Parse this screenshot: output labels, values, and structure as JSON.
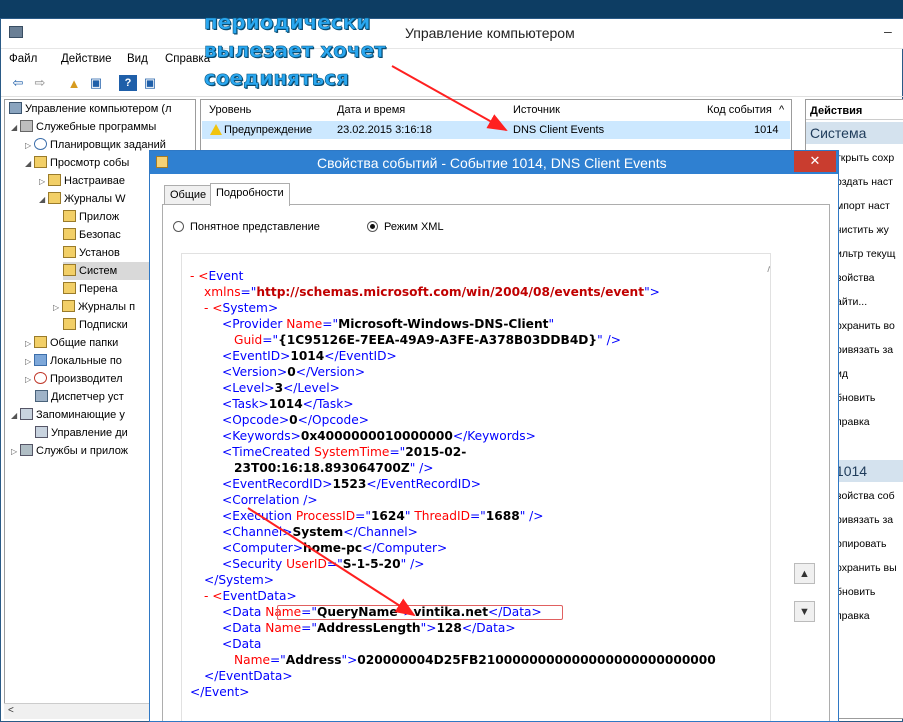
{
  "window": {
    "title": "Управление компьютером",
    "min_glyph": "–"
  },
  "menu": [
    "Файл",
    "Действие",
    "Вид",
    "Справка"
  ],
  "caption_lines": [
    "периодически",
    "вылезает хочет",
    "соединяться"
  ],
  "tree": [
    {
      "label": "Управление компьютером (л",
      "indent": 0
    },
    {
      "label": "Служебные программы",
      "indent": 1,
      "arrow": "◢"
    },
    {
      "label": "Планировщик заданий",
      "indent": 2,
      "arrow": "▷"
    },
    {
      "label": "Просмотр собы",
      "indent": 2,
      "arrow": "◢"
    },
    {
      "label": "Настраивае",
      "indent": 3,
      "arrow": "▷"
    },
    {
      "label": "Журналы W",
      "indent": 3,
      "arrow": "◢"
    },
    {
      "label": "Прилож",
      "indent": 4
    },
    {
      "label": "Безопас",
      "indent": 4
    },
    {
      "label": "Установ",
      "indent": 4
    },
    {
      "label": "Систем",
      "indent": 4
    },
    {
      "label": "Перена",
      "indent": 4
    },
    {
      "label": "Журналы п",
      "indent": 3,
      "arrow": "▷"
    },
    {
      "label": "Подписки",
      "indent": 3
    },
    {
      "label": "Общие папки",
      "indent": 2,
      "arrow": "▷"
    },
    {
      "label": "Локальные по",
      "indent": 2,
      "arrow": "▷"
    },
    {
      "label": "Производител",
      "indent": 2,
      "arrow": "▷"
    },
    {
      "label": "Диспетчер уст",
      "indent": 2
    },
    {
      "label": "Запоминающие у",
      "indent": 1,
      "arrow": "◢"
    },
    {
      "label": "Управление ди",
      "indent": 2
    },
    {
      "label": "Службы и прилож",
      "indent": 1,
      "arrow": "▷"
    }
  ],
  "list": {
    "columns": [
      "Уровень",
      "Дата и время",
      "Источник",
      "Код события"
    ],
    "sort_glyph": "^",
    "rows": [
      {
        "level": "Предупреждение",
        "datetime": "23.02.2015 3:16:18",
        "source": "DNS Client Events",
        "code": "1014"
      }
    ]
  },
  "actions": {
    "header": "Действия",
    "section1": "Система",
    "items1": [
      "ткрыть сохр",
      "оздать наст",
      "мпорт наст",
      "чистить жу",
      "ильтр текущ",
      "войства",
      "айти...",
      "охранить во",
      "ривязать за",
      "ид",
      "бновить",
      "правка"
    ],
    "section2": "тие 1014",
    "items2": [
      "войства соб",
      "ривязать за",
      "опировать",
      "охранить вы",
      "бновить",
      "правка"
    ]
  },
  "props": {
    "title": "Свойства событий - Событие 1014, DNS Client Events",
    "close": "✕",
    "tabs": [
      "Общие",
      "Подробности"
    ],
    "radio_friendly": "Понятное представление",
    "radio_xml": "Режим XML"
  },
  "xml": {
    "l1a": "- <",
    "l1b": "Event",
    "l2a": "xmlns",
    "l2b": "=\"",
    "l2c": "http://schemas.microsoft.com/win/2004/08/events/event",
    "l2d": "\">",
    "l3a": "- <",
    "l3b": "System",
    "l3c": ">",
    "l4a": "<",
    "l4b": "Provider ",
    "l4c": "Name",
    "l4d": "=\"",
    "l4e": "Microsoft-Windows-DNS-Client",
    "l4f": "\"",
    "l5a": "Guid",
    "l5b": "=\"",
    "l5c": "{1C95126E-7EEA-49A9-A3FE-A378B03DDB4D}",
    "l5d": "\" />",
    "eventid": "1014",
    "version": "0",
    "level": "3",
    "task": "1014",
    "opcode": "0",
    "keywords": "0x4000000010000000",
    "tc_a": "<",
    "tc_b": "TimeCreated ",
    "tc_c": "SystemTime",
    "tc_d": "=\"",
    "tc_e": "2015-02-",
    "tc_f": "23T00:16:18.893064700Z",
    "tc_g": "\" />",
    "recordid": "1523",
    "correlation": "<Correlation />",
    "exec_a": "<",
    "exec_b": "Execution ",
    "exec_c": "ProcessID",
    "exec_d": "=\"",
    "exec_e": "1624",
    "exec_f": "\" ",
    "exec_g": "ThreadID",
    "exec_h": "=\"",
    "exec_i": "1688",
    "exec_j": "\" />",
    "channel": "System",
    "computer": "home-pc",
    "sec_a": "<",
    "sec_b": "Security ",
    "sec_c": "UserID",
    "sec_d": "=\"",
    "sec_e": "S-1-5-20",
    "sec_f": "\" />",
    "sys_close": "</System>",
    "ed_a": "- <",
    "ed_b": "EventData",
    "ed_c": ">",
    "d1_name": "QueryName",
    "d1_val": "vintika.net",
    "d2_name": "AddressLength",
    "d2_val": "128",
    "d3_open": "<Data",
    "d3_name": "Address",
    "d3_val": "020000004D25FB2100000000000000000000000000",
    "ed_close": "</EventData>",
    "ev_close": "</Event>",
    "tag_eventid": "EventID",
    "tag_version": "Version",
    "tag_level": "Level",
    "tag_task": "Task",
    "tag_opcode": "Opcode",
    "tag_keywords": "Keywords",
    "tag_recordid": "EventRecordID",
    "tag_channel": "Channel",
    "tag_computer": "Computer",
    "tag_data": "Data",
    "attr_name": "Name"
  }
}
